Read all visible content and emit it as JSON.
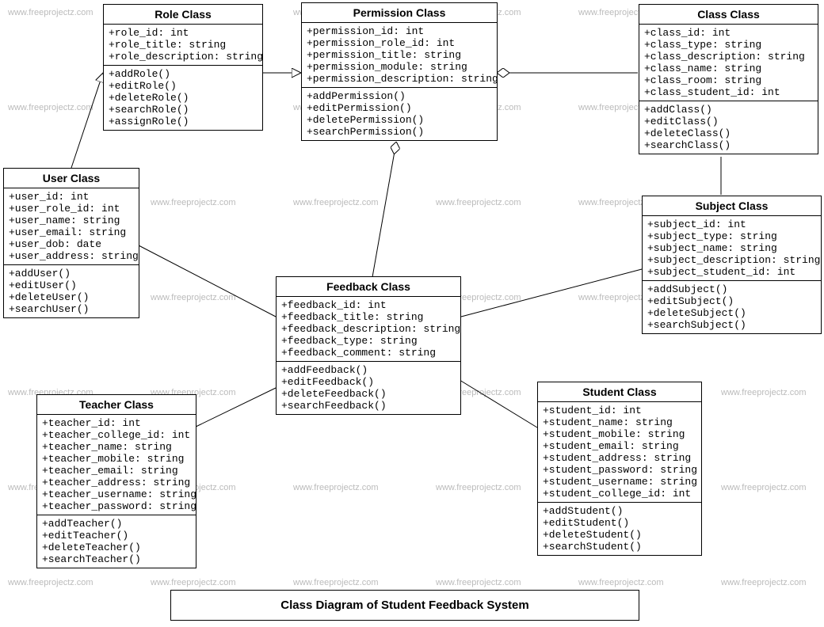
{
  "watermark_text": "www.freeprojectz.com",
  "caption": "Class Diagram of Student Feedback System",
  "classes": {
    "role": {
      "title": "Role Class",
      "attrs": [
        "+role_id: int",
        "+role_title: string",
        "+role_description: string"
      ],
      "ops": [
        "+addRole()",
        "+editRole()",
        "+deleteRole()",
        "+searchRole()",
        "+assignRole()"
      ]
    },
    "permission": {
      "title": "Permission Class",
      "attrs": [
        "+permission_id: int",
        "+permission_role_id: int",
        "+permission_title: string",
        "+permission_module: string",
        "+permission_description: string"
      ],
      "ops": [
        "+addPermission()",
        "+editPermission()",
        "+deletePermission()",
        "+searchPermission()"
      ]
    },
    "classcls": {
      "title": "Class Class",
      "attrs": [
        "+class_id: int",
        "+class_type: string",
        "+class_description: string",
        "+class_name: string",
        "+class_room: string",
        "+class_student_id: int"
      ],
      "ops": [
        "+addClass()",
        "+editClass()",
        "+deleteClass()",
        "+searchClass()"
      ]
    },
    "user": {
      "title": "User Class",
      "attrs": [
        "+user_id: int",
        "+user_role_id: int",
        "+user_name: string",
        "+user_email: string",
        "+user_dob: date",
        "+user_address: string"
      ],
      "ops": [
        "+addUser()",
        "+editUser()",
        "+deleteUser()",
        "+searchUser()"
      ]
    },
    "feedback": {
      "title": "Feedback Class",
      "attrs": [
        "+feedback_id: int",
        "+feedback_title: string",
        "+feedback_description: string",
        "+feedback_type: string",
        "+feedback_comment: string"
      ],
      "ops": [
        "+addFeedback()",
        "+editFeedback()",
        "+deleteFeedback()",
        "+searchFeedback()"
      ]
    },
    "subject": {
      "title": "Subject Class",
      "attrs": [
        "+subject_id: int",
        "+subject_type: string",
        "+subject_name: string",
        "+subject_description: string",
        "+subject_student_id: int"
      ],
      "ops": [
        "+addSubject()",
        "+editSubject()",
        "+deleteSubject()",
        "+searchSubject()"
      ]
    },
    "teacher": {
      "title": "Teacher Class",
      "attrs": [
        "+teacher_id: int",
        "+teacher_college_id: int",
        "+teacher_name: string",
        "+teacher_mobile: string",
        "+teacher_email: string",
        "+teacher_address: string",
        "+teacher_username: string",
        "+teacher_password: string"
      ],
      "ops": [
        "+addTeacher()",
        "+editTeacher()",
        "+deleteTeacher()",
        "+searchTeacher()"
      ]
    },
    "student": {
      "title": "Student Class",
      "attrs": [
        "+student_id: int",
        "+student_name: string",
        "+student_mobile: string",
        "+student_email: string",
        "+student_address: string",
        "+student_password: string",
        "+student_username: string",
        "+student_college_id: int"
      ],
      "ops": [
        "+addStudent()",
        "+editStudent()",
        "+deleteStudent()",
        "+searchStudent()"
      ]
    }
  },
  "chart_data": {
    "type": "uml_class_diagram",
    "title": "Class Diagram of Student Feedback System",
    "classes": [
      {
        "name": "Role Class",
        "attributes": [
          "role_id: int",
          "role_title: string",
          "role_description: string"
        ],
        "operations": [
          "addRole()",
          "editRole()",
          "deleteRole()",
          "searchRole()",
          "assignRole()"
        ]
      },
      {
        "name": "Permission Class",
        "attributes": [
          "permission_id: int",
          "permission_role_id: int",
          "permission_title: string",
          "permission_module: string",
          "permission_description: string"
        ],
        "operations": [
          "addPermission()",
          "editPermission()",
          "deletePermission()",
          "searchPermission()"
        ]
      },
      {
        "name": "Class Class",
        "attributes": [
          "class_id: int",
          "class_type: string",
          "class_description: string",
          "class_name: string",
          "class_room: string",
          "class_student_id: int"
        ],
        "operations": [
          "addClass()",
          "editClass()",
          "deleteClass()",
          "searchClass()"
        ]
      },
      {
        "name": "User Class",
        "attributes": [
          "user_id: int",
          "user_role_id: int",
          "user_name: string",
          "user_email: string",
          "user_dob: date",
          "user_address: string"
        ],
        "operations": [
          "addUser()",
          "editUser()",
          "deleteUser()",
          "searchUser()"
        ]
      },
      {
        "name": "Feedback Class",
        "attributes": [
          "feedback_id: int",
          "feedback_title: string",
          "feedback_description: string",
          "feedback_type: string",
          "feedback_comment: string"
        ],
        "operations": [
          "addFeedback()",
          "editFeedback()",
          "deleteFeedback()",
          "searchFeedback()"
        ]
      },
      {
        "name": "Subject Class",
        "attributes": [
          "subject_id: int",
          "subject_type: string",
          "subject_name: string",
          "subject_description: string",
          "subject_student_id: int"
        ],
        "operations": [
          "addSubject()",
          "editSubject()",
          "deleteSubject()",
          "searchSubject()"
        ]
      },
      {
        "name": "Teacher Class",
        "attributes": [
          "teacher_id: int",
          "teacher_college_id: int",
          "teacher_name: string",
          "teacher_mobile: string",
          "teacher_email: string",
          "teacher_address: string",
          "teacher_username: string",
          "teacher_password: string"
        ],
        "operations": [
          "addTeacher()",
          "editTeacher()",
          "deleteTeacher()",
          "searchTeacher()"
        ]
      },
      {
        "name": "Student Class",
        "attributes": [
          "student_id: int",
          "student_name: string",
          "student_mobile: string",
          "student_email: string",
          "student_address: string",
          "student_password: string",
          "student_username: string",
          "student_college_id: int"
        ],
        "operations": [
          "addStudent()",
          "editStudent()",
          "deleteStudent()",
          "searchStudent()"
        ]
      }
    ],
    "relationships": [
      {
        "from": "User Class",
        "to": "Role Class",
        "type": "generalization"
      },
      {
        "from": "Role Class",
        "to": "Permission Class",
        "type": "generalization"
      },
      {
        "from": "Permission Class",
        "to": "Class Class",
        "type": "aggregation"
      },
      {
        "from": "Permission Class",
        "to": "Feedback Class",
        "type": "aggregation"
      },
      {
        "from": "User Class",
        "to": "Feedback Class",
        "type": "association"
      },
      {
        "from": "Feedback Class",
        "to": "Teacher Class",
        "type": "association"
      },
      {
        "from": "Feedback Class",
        "to": "Student Class",
        "type": "association"
      },
      {
        "from": "Feedback Class",
        "to": "Subject Class",
        "type": "association"
      },
      {
        "from": "Class Class",
        "to": "Subject Class",
        "type": "association"
      }
    ]
  }
}
